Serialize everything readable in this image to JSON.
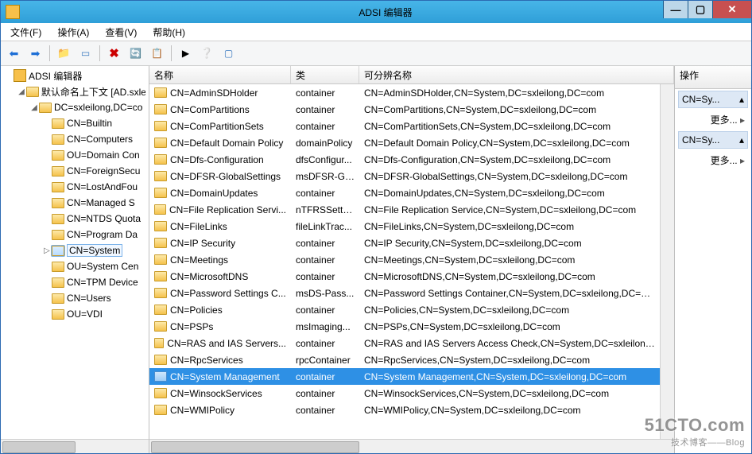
{
  "window": {
    "title": "ADSI 编辑器"
  },
  "menu": {
    "file": "文件(F)",
    "action": "操作(A)",
    "view": "查看(V)",
    "help": "帮助(H)"
  },
  "columns": {
    "name": "名称",
    "class": "类",
    "dn": "可分辨名称"
  },
  "actions": {
    "header": "操作",
    "group1": "CN=Sy...",
    "group2": "CN=Sy...",
    "more": "更多..."
  },
  "watermark": {
    "line1": "51CTO.com",
    "line2": "技术博客——Blog"
  },
  "tree": [
    {
      "indent": 0,
      "twist": "",
      "icon": "root",
      "label": "ADSI 编辑器"
    },
    {
      "indent": 1,
      "twist": "◢",
      "icon": "folder",
      "label": "默认命名上下文 [AD.sxle"
    },
    {
      "indent": 2,
      "twist": "◢",
      "icon": "folder",
      "label": "DC=sxleilong,DC=co"
    },
    {
      "indent": 3,
      "twist": "",
      "icon": "folder",
      "label": "CN=Builtin"
    },
    {
      "indent": 3,
      "twist": "",
      "icon": "folder",
      "label": "CN=Computers"
    },
    {
      "indent": 3,
      "twist": "",
      "icon": "folder",
      "label": "OU=Domain Con"
    },
    {
      "indent": 3,
      "twist": "",
      "icon": "folder",
      "label": "CN=ForeignSecu"
    },
    {
      "indent": 3,
      "twist": "",
      "icon": "folder",
      "label": "CN=LostAndFou"
    },
    {
      "indent": 3,
      "twist": "",
      "icon": "folder",
      "label": "CN=Managed S"
    },
    {
      "indent": 3,
      "twist": "",
      "icon": "folder",
      "label": "CN=NTDS Quota"
    },
    {
      "indent": 3,
      "twist": "",
      "icon": "folder",
      "label": "CN=Program Da"
    },
    {
      "indent": 3,
      "twist": "▷",
      "icon": "folder",
      "label": "CN=System",
      "selected": true
    },
    {
      "indent": 3,
      "twist": "",
      "icon": "folder",
      "label": "OU=System Cen"
    },
    {
      "indent": 3,
      "twist": "",
      "icon": "folder",
      "label": "CN=TPM Device"
    },
    {
      "indent": 3,
      "twist": "",
      "icon": "folder",
      "label": "CN=Users"
    },
    {
      "indent": 3,
      "twist": "",
      "icon": "folder",
      "label": "OU=VDI"
    }
  ],
  "rows": [
    {
      "name": "CN=AdminSDHolder",
      "class": "container",
      "dn": "CN=AdminSDHolder,CN=System,DC=sxleilong,DC=com"
    },
    {
      "name": "CN=ComPartitions",
      "class": "container",
      "dn": "CN=ComPartitions,CN=System,DC=sxleilong,DC=com"
    },
    {
      "name": "CN=ComPartitionSets",
      "class": "container",
      "dn": "CN=ComPartitionSets,CN=System,DC=sxleilong,DC=com"
    },
    {
      "name": "CN=Default Domain Policy",
      "class": "domainPolicy",
      "dn": "CN=Default Domain Policy,CN=System,DC=sxleilong,DC=com"
    },
    {
      "name": "CN=Dfs-Configuration",
      "class": "dfsConfigur...",
      "dn": "CN=Dfs-Configuration,CN=System,DC=sxleilong,DC=com"
    },
    {
      "name": "CN=DFSR-GlobalSettings",
      "class": "msDFSR-Gl...",
      "dn": "CN=DFSR-GlobalSettings,CN=System,DC=sxleilong,DC=com"
    },
    {
      "name": "CN=DomainUpdates",
      "class": "container",
      "dn": "CN=DomainUpdates,CN=System,DC=sxleilong,DC=com"
    },
    {
      "name": "CN=File Replication Servi...",
      "class": "nTFRSSettin...",
      "dn": "CN=File Replication Service,CN=System,DC=sxleilong,DC=com"
    },
    {
      "name": "CN=FileLinks",
      "class": "fileLinkTrac...",
      "dn": "CN=FileLinks,CN=System,DC=sxleilong,DC=com"
    },
    {
      "name": "CN=IP Security",
      "class": "container",
      "dn": "CN=IP Security,CN=System,DC=sxleilong,DC=com"
    },
    {
      "name": "CN=Meetings",
      "class": "container",
      "dn": "CN=Meetings,CN=System,DC=sxleilong,DC=com"
    },
    {
      "name": "CN=MicrosoftDNS",
      "class": "container",
      "dn": "CN=MicrosoftDNS,CN=System,DC=sxleilong,DC=com"
    },
    {
      "name": "CN=Password Settings C...",
      "class": "msDS-Pass...",
      "dn": "CN=Password Settings Container,CN=System,DC=sxleilong,DC=com"
    },
    {
      "name": "CN=Policies",
      "class": "container",
      "dn": "CN=Policies,CN=System,DC=sxleilong,DC=com"
    },
    {
      "name": "CN=PSPs",
      "class": "msImaging...",
      "dn": "CN=PSPs,CN=System,DC=sxleilong,DC=com"
    },
    {
      "name": "CN=RAS and IAS Servers...",
      "class": "container",
      "dn": "CN=RAS and IAS Servers Access Check,CN=System,DC=sxleilong,DC=com"
    },
    {
      "name": "CN=RpcServices",
      "class": "rpcContainer",
      "dn": "CN=RpcServices,CN=System,DC=sxleilong,DC=com"
    },
    {
      "name": "CN=System Management",
      "class": "container",
      "dn": "CN=System Management,CN=System,DC=sxleilong,DC=com",
      "selected": true
    },
    {
      "name": "CN=WinsockServices",
      "class": "container",
      "dn": "CN=WinsockServices,CN=System,DC=sxleilong,DC=com"
    },
    {
      "name": "CN=WMIPolicy",
      "class": "container",
      "dn": "CN=WMIPolicy,CN=System,DC=sxleilong,DC=com"
    }
  ]
}
